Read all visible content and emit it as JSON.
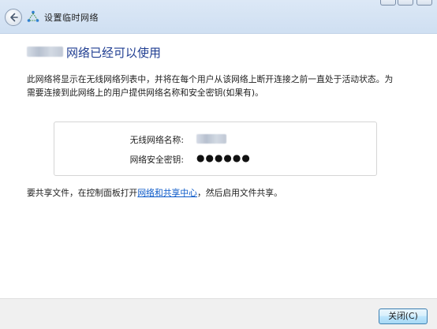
{
  "window": {
    "title": "设置临时网络"
  },
  "main": {
    "heading": "网络已经可以使用",
    "description": "此网络将显示在无线网络列表中，并将在每个用户从该网络上断开连接之前一直处于活动状态。为需要连接到此网络上的用户提供网络名称和安全密钥(如果有)。",
    "network_name_label": "无线网络名称:",
    "security_key_label": "网络安全密钥:",
    "security_key_value": "●●●●●●",
    "share_prefix": "要共享文件，在控制面板打开",
    "share_link": "网络和共享中心",
    "share_suffix": "，然后启用文件共享。"
  },
  "footer": {
    "close_label": "关闭(C)"
  },
  "colors": {
    "heading": "#1f3d91",
    "link": "#0b59c8",
    "header_bg": "#dce8f6"
  },
  "icons": [
    "back-arrow-icon",
    "network-icon"
  ]
}
